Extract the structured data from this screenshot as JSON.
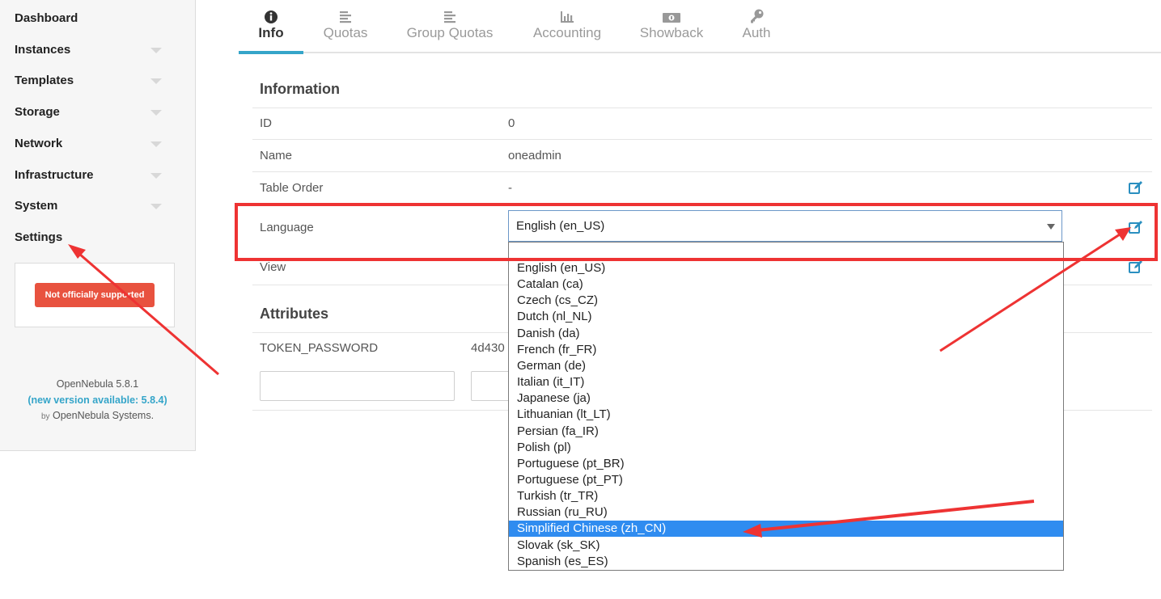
{
  "sidebar": {
    "items": [
      {
        "label": "Dashboard",
        "caret": false
      },
      {
        "label": "Instances",
        "caret": true
      },
      {
        "label": "Templates",
        "caret": true
      },
      {
        "label": "Storage",
        "caret": true
      },
      {
        "label": "Network",
        "caret": true
      },
      {
        "label": "Infrastructure",
        "caret": true
      },
      {
        "label": "System",
        "caret": true
      },
      {
        "label": "Settings",
        "caret": false
      }
    ],
    "support_badge": "Not officially supported",
    "version": "OpenNebula 5.8.1",
    "new_version": "(new version available: 5.8.4)",
    "by_prefix": "by",
    "by_company": "OpenNebula Systems."
  },
  "tabs": [
    {
      "label": "Info",
      "icon": "info-circle-icon",
      "active": true
    },
    {
      "label": "Quotas",
      "icon": "list-lines-icon",
      "active": false
    },
    {
      "label": "Group Quotas",
      "icon": "list-lines-icon",
      "active": false
    },
    {
      "label": "Accounting",
      "icon": "bar-chart-icon",
      "active": false
    },
    {
      "label": "Showback",
      "icon": "money-bill-icon",
      "active": false
    },
    {
      "label": "Auth",
      "icon": "key-icon",
      "active": false
    }
  ],
  "information": {
    "title": "Information",
    "rows": [
      {
        "label": "ID",
        "value": "0"
      },
      {
        "label": "Name",
        "value": "oneadmin"
      },
      {
        "label": "Table Order",
        "value": "-"
      },
      {
        "label": "Language",
        "value": "English (en_US)"
      },
      {
        "label": "View",
        "value": ""
      }
    ]
  },
  "language_dropdown": {
    "selected": "English (en_US)",
    "highlighted": "Simplified Chinese (zh_CN)",
    "options": [
      "English (en_US)",
      "Catalan (ca)",
      "Czech (cs_CZ)",
      "Dutch (nl_NL)",
      "Danish (da)",
      "French (fr_FR)",
      "German (de)",
      "Italian (it_IT)",
      "Japanese (ja)",
      "Lithuanian (lt_LT)",
      "Persian (fa_IR)",
      "Polish (pl)",
      "Portuguese (pt_BR)",
      "Portuguese (pt_PT)",
      "Turkish (tr_TR)",
      "Russian (ru_RU)",
      "Simplified Chinese (zh_CN)",
      "Slovak (sk_SK)",
      "Spanish (es_ES)"
    ]
  },
  "attributes": {
    "title": "Attributes",
    "rows": [
      {
        "key": "TOKEN_PASSWORD",
        "value": "4d430"
      }
    ]
  },
  "colors": {
    "accent": "#35a5c9",
    "annotation_red": "#ee3333",
    "badge_red": "#e8523f",
    "selected_option": "#2f8cf0"
  }
}
